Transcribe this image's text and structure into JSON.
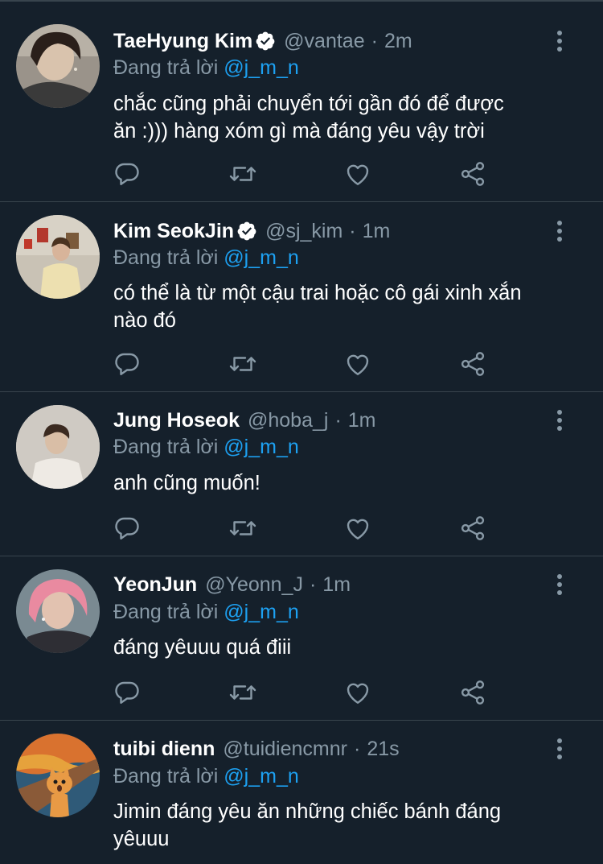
{
  "reply_prefix": "Đang trả lời",
  "tweets": [
    {
      "name": "TaeHyung Kim",
      "verified": true,
      "handle": "@vantae",
      "separator": "·",
      "time": "2m",
      "reply_to": "@j_m_n",
      "text_lines": [
        "chắc cũng phải chuyển tới gần đó để được",
        "ăn :))) hàng xóm gì mà đáng yêu vậy trời"
      ]
    },
    {
      "name": "Kim SeokJin",
      "verified": true,
      "handle": "@sj_kim",
      "separator": "·",
      "time": "1m",
      "reply_to": "@j_m_n",
      "text_lines": [
        "có thể là từ một cậu trai hoặc cô gái xinh xắn",
        "nào đó"
      ]
    },
    {
      "name": "Jung Hoseok",
      "verified": false,
      "handle": "@hoba_j",
      "separator": "·",
      "time": "1m",
      "reply_to": "@j_m_n",
      "text_lines": [
        "anh cũng muốn!"
      ]
    },
    {
      "name": "YeonJun",
      "verified": false,
      "handle": "@Yeonn_J",
      "separator": "·",
      "time": "1m",
      "reply_to": "@j_m_n",
      "text_lines": [
        "đáng yêuuu quá điii"
      ]
    },
    {
      "name": "tuibi dienn",
      "verified": false,
      "handle": "@tuidiencmnr",
      "separator": "·",
      "time": "21s",
      "reply_to": "@j_m_n",
      "text_lines": [
        "Jimin đáng yêu ăn những chiếc bánh đáng",
        "yêuuu"
      ]
    }
  ],
  "icons": [
    "verified-badge-icon",
    "more-options-icon",
    "reply-icon",
    "retweet-icon",
    "like-icon",
    "share-icon"
  ],
  "colors": {
    "background": "#15202b",
    "divider": "#38444d",
    "secondary_text": "#8899a6",
    "mention": "#1da1f2"
  }
}
